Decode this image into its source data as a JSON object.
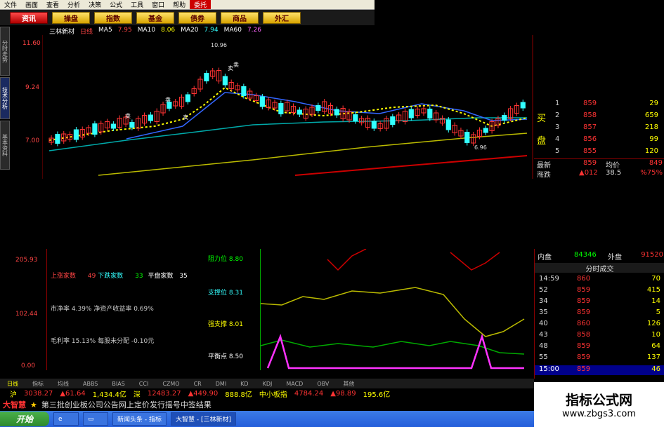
{
  "menubar": {
    "items": [
      "文件",
      "画面",
      "查看",
      "分析",
      "决策",
      "公式",
      "工具",
      "窗口",
      "帮助"
    ],
    "highlight": "委托"
  },
  "navbar": {
    "buttons": [
      "资讯",
      "操盘",
      "指数",
      "基金",
      "债券",
      "商品",
      "外汇"
    ]
  },
  "quote": {
    "name": "三林新材",
    "code": "日线",
    "fields": [
      "MA5",
      "7.95",
      "MA10",
      "8.06",
      "MA20",
      "7.94",
      "MA60",
      "7.26"
    ]
  },
  "left_tabs": [
    "分时走势",
    "技术分析",
    "基本资料"
  ],
  "price_axis": [
    "11.60",
    "9.24",
    "7.00"
  ],
  "chart_data": {
    "type": "candlestick",
    "annotations": [
      {
        "text": "10.96",
        "x_index": 29,
        "y": 10.96
      },
      {
        "text": "6.96",
        "x_index": 69,
        "y": 6.96
      }
    ],
    "signals": [
      "卖",
      "卖",
      "卖",
      "卖",
      "卖"
    ]
  },
  "order_book": {
    "label_buy": "买",
    "label_sell": "盘",
    "rows": [
      {
        "n": "1",
        "price": "859",
        "vol": "29"
      },
      {
        "n": "2",
        "price": "858",
        "vol": "659"
      },
      {
        "n": "3",
        "price": "857",
        "vol": "218"
      },
      {
        "n": "4",
        "price": "856",
        "vol": "99"
      },
      {
        "n": "5",
        "price": "855",
        "vol": "120"
      }
    ],
    "latest_label": "最新",
    "latest": "859",
    "avg_label": "均价",
    "avg": "849",
    "change_label": "涨跌",
    "change": "▲012",
    "change_pct": "38.5",
    "change_rate": "%75%"
  },
  "indicator": {
    "axis": [
      "205.93",
      "102.44",
      "0.00"
    ],
    "stats": {
      "up_label": "上涨家数",
      "up_val": "49",
      "down_label": "下跌家数",
      "down_val": "33",
      "flat_label": "平盘家数",
      "flat_val": "35"
    },
    "lines": [
      {
        "label": "市净率",
        "text": "4.39%  净资产收益率  0.69%"
      },
      {
        "label": "毛利率",
        "text": "15.13%  每股未分配  -0.10元"
      }
    ],
    "legend": [
      {
        "label": "阻力位",
        "val": "8.80"
      },
      {
        "label": "支撑位",
        "val": "8.31"
      },
      {
        "label": "强支撑",
        "val": "8.01"
      },
      {
        "label": "平衡点",
        "val": "8.50"
      }
    ]
  },
  "trade_panel": {
    "inner_label": "内盘",
    "inner": "84346",
    "outer_label": "外盘",
    "outer": "91520",
    "title": "分时成交",
    "rows": [
      {
        "time": "14:59",
        "price": "860",
        "vol": "70"
      },
      {
        "time": "52",
        "price": "859",
        "vol": "415"
      },
      {
        "time": "34",
        "price": "859",
        "vol": "14"
      },
      {
        "time": "35",
        "price": "859",
        "vol": "5"
      },
      {
        "time": "40",
        "price": "860",
        "vol": "126"
      },
      {
        "time": "43",
        "price": "858",
        "vol": "10"
      },
      {
        "time": "48",
        "price": "859",
        "vol": "64"
      },
      {
        "time": "55",
        "price": "859",
        "vol": "137"
      },
      {
        "time": "15:00",
        "price": "859",
        "vol": "46"
      }
    ]
  },
  "tabbar": {
    "items": [
      "日线",
      "指标",
      "均线",
      "ABBS",
      "BIAS",
      "CCI",
      "CZMO",
      "CR",
      "DMI",
      "KD",
      "KDJ",
      "MACD",
      "OBV",
      "其他"
    ]
  },
  "indexbar": {
    "sh_label": "沪",
    "sh": "3038.27",
    "sh_chg": "▲61.64",
    "sh_amt": "1,434.4亿",
    "sz_label": "深",
    "sz": "12483.27",
    "sz_chg": "▲449.90",
    "sz_amt": "888.8亿",
    "sme_label": "中小板指",
    "sme": "4784.24",
    "sme_chg": "▲98.89",
    "sme_amt": "195.6亿"
  },
  "news": {
    "brand": "大智慧",
    "text": "第三批创业板公司公告网上定价发行摇号中签结果"
  },
  "taskbar": {
    "start": "开始",
    "items": [
      "新闻头条 - 指标",
      "大智慧 - [三林新材]"
    ]
  },
  "watermark": {
    "line1": "指标公式网",
    "line2": "www.zbgs3.com"
  },
  "colors": {
    "up": "#ff3333",
    "down": "#33ffff",
    "bg": "#000000",
    "grid": "#8b0000"
  }
}
